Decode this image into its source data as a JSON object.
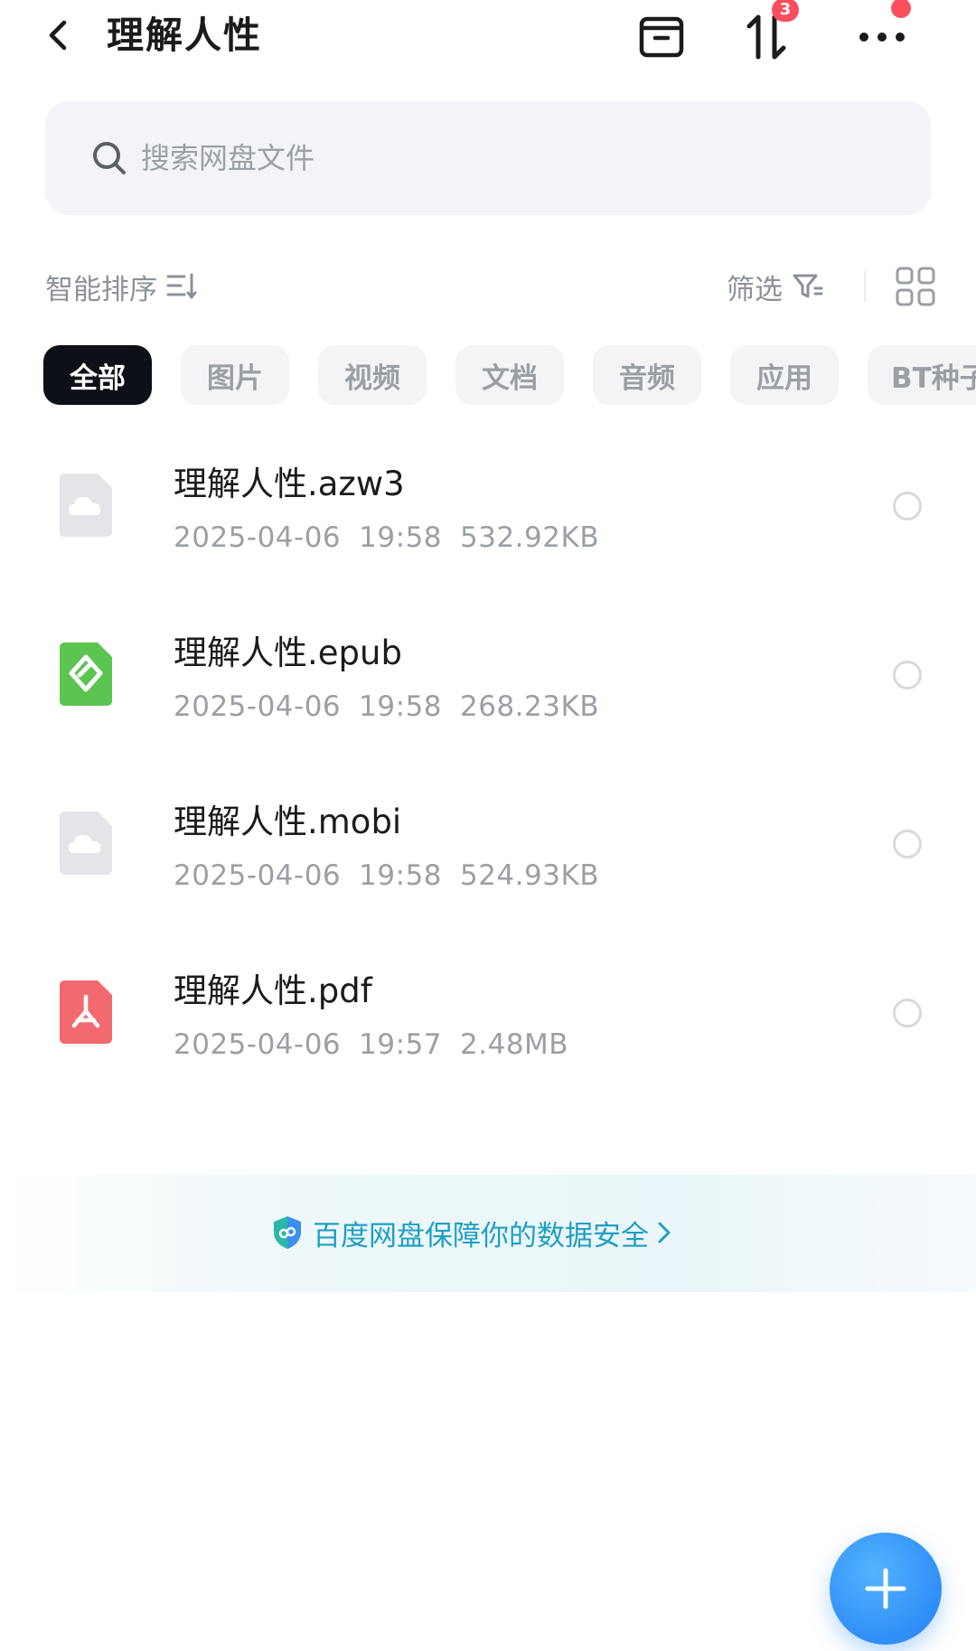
{
  "header": {
    "title": "理解人性",
    "transfer_badge": "3"
  },
  "search": {
    "placeholder": "搜索网盘文件"
  },
  "toolbar": {
    "sort_label": "智能排序",
    "filter_label": "筛选"
  },
  "tabs": [
    {
      "label": "全部",
      "active": true
    },
    {
      "label": "图片",
      "active": false
    },
    {
      "label": "视频",
      "active": false
    },
    {
      "label": "文档",
      "active": false
    },
    {
      "label": "音频",
      "active": false
    },
    {
      "label": "应用",
      "active": false
    },
    {
      "label": "BT种子",
      "active": false
    }
  ],
  "files": [
    {
      "name": "理解人性.azw3",
      "date": "2025-04-06",
      "time": "19:58",
      "size": "532.92KB",
      "icon": "cloud-file-icon"
    },
    {
      "name": "理解人性.epub",
      "date": "2025-04-06",
      "time": "19:58",
      "size": "268.23KB",
      "icon": "epub-file-icon"
    },
    {
      "name": "理解人性.mobi",
      "date": "2025-04-06",
      "time": "19:58",
      "size": "524.93KB",
      "icon": "cloud-file-icon"
    },
    {
      "name": "理解人性.pdf",
      "date": "2025-04-06",
      "time": "19:57",
      "size": "2.48MB",
      "icon": "pdf-file-icon"
    }
  ],
  "banner": {
    "text": "百度网盘保障你的数据安全"
  },
  "colors": {
    "accent_blue": "#2f8ef7",
    "badge_red": "#ff4d5b",
    "epub_green": "#5cc451",
    "pdf_red": "#f26a6f",
    "banner_text": "#1f9fc4"
  }
}
